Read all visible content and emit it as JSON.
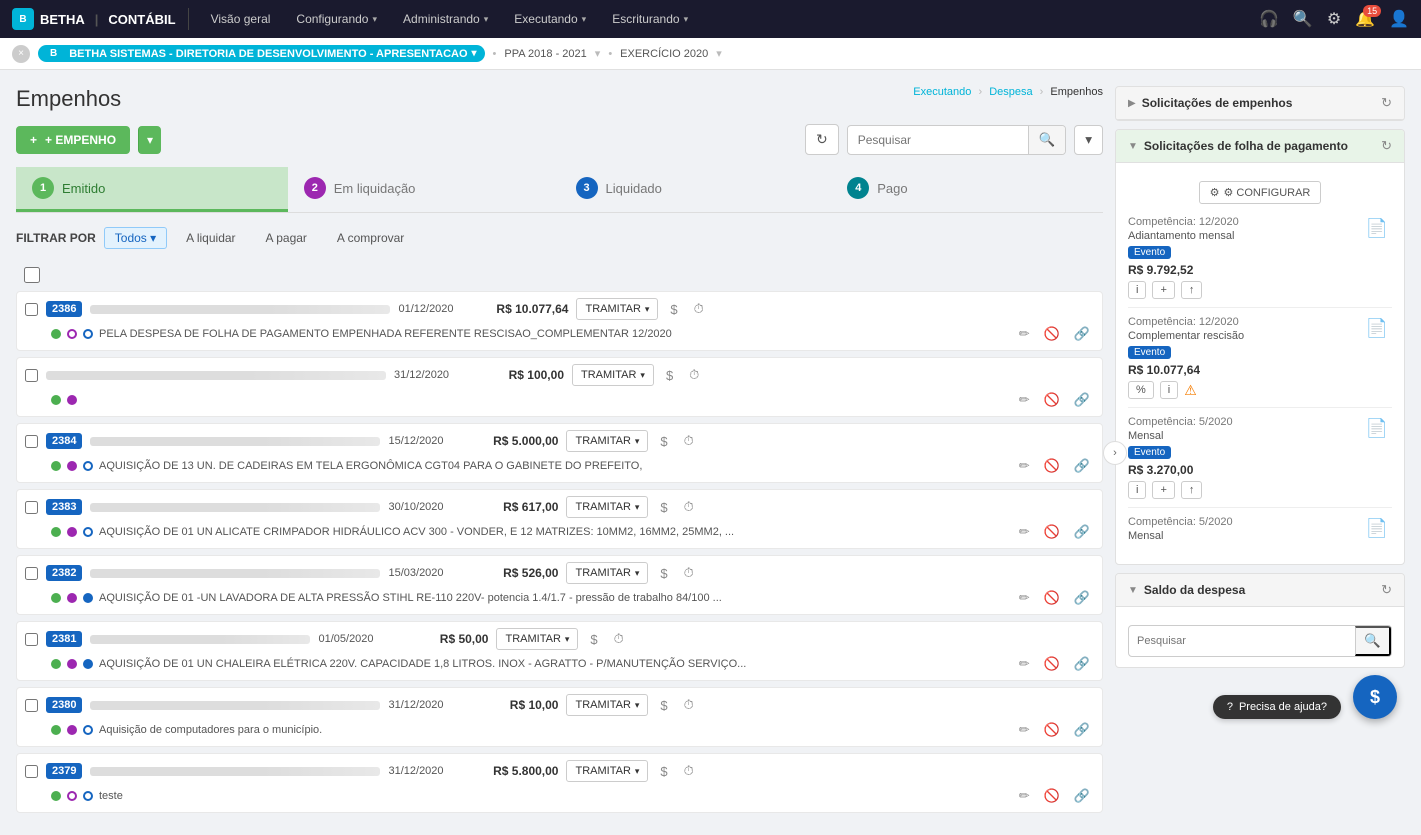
{
  "topNav": {
    "brandIcon": "B",
    "brandName": "BETHA",
    "appName": "CONTÁBIL",
    "navItems": [
      {
        "label": "Visão geral",
        "hasDropdown": false
      },
      {
        "label": "Configurando",
        "hasDropdown": true
      },
      {
        "label": "Administrando",
        "hasDropdown": true
      },
      {
        "label": "Executando",
        "hasDropdown": true
      },
      {
        "label": "Escriturando",
        "hasDropdown": true
      }
    ],
    "icons": {
      "headphones": "🎧",
      "search": "🔍",
      "settings": "⚙",
      "bell": "🔔",
      "user": "👤",
      "bellBadge": "15"
    }
  },
  "breadcrumbBar": {
    "close": "×",
    "logo": "BETHA",
    "orgText": "BETHA SISTEMAS - DIRETORIA DE DESENVOLVIMENTO - APRESENTACAO",
    "ppa": "PPA 2018 - 2021",
    "exercicio": "EXERCÍCIO 2020",
    "chevron": "▾"
  },
  "page": {
    "title": "Empenhos",
    "breadcrumb": [
      "Executando",
      "Despesa",
      "Empenhos"
    ]
  },
  "toolbar": {
    "addLabel": "+ EMPENHO",
    "refreshTitle": "Atualizar",
    "searchPlaceholder": "Pesquisar"
  },
  "tabs": [
    {
      "num": "1",
      "label": "Emitido",
      "active": true
    },
    {
      "num": "2",
      "label": "Em liquidação",
      "active": false
    },
    {
      "num": "3",
      "label": "Liquidado",
      "active": false
    },
    {
      "num": "4",
      "label": "Pago",
      "active": false
    }
  ],
  "filters": {
    "label": "FILTRAR POR",
    "options": [
      "Todos",
      "A liquidar",
      "A pagar",
      "A comprovar"
    ]
  },
  "empenhos": [
    {
      "id": "2386",
      "date": "01/12/2020",
      "value": "R$ 10.077,64",
      "description": "PELA DESPESA DE FOLHA DE PAGAMENTO EMPENHADA REFERENTE RESCISAO_COMPLEMENTAR 12/2020",
      "dots": [
        "green",
        "empty-purple",
        "empty-blue"
      ],
      "action": "TRAMITAR"
    },
    {
      "id": "",
      "date": "31/12/2020",
      "value": "R$ 100,00",
      "description": "",
      "dots": [
        "green",
        "purple"
      ],
      "action": "TRAMITAR"
    },
    {
      "id": "2384",
      "date": "15/12/2020",
      "value": "R$ 5.000,00",
      "description": "AQUISIÇÃO DE 13 UN. DE CADEIRAS EM TELA ERGONÔMICA CGT04 PARA O GABINETE DO PREFEITO,",
      "dots": [
        "green",
        "purple",
        "empty-blue"
      ],
      "action": "TRAMITAR"
    },
    {
      "id": "2383",
      "date": "30/10/2020",
      "value": "R$ 617,00",
      "description": "AQUISIÇÃO DE 01 UN ALICATE CRIMPADOR HIDRÁULICO ACV 300 - VONDER, E 12 MATRIZES: 10MM2, 16MM2, 25MM2, ...",
      "dots": [
        "green",
        "purple",
        "empty-blue"
      ],
      "action": "TRAMITAR"
    },
    {
      "id": "2382",
      "date": "15/03/2020",
      "value": "R$ 526,00",
      "description": "AQUISIÇÃO DE 01 -UN LAVADORA DE ALTA PRESSÃO STIHL RE-110 220V- potencia 1.4/1.7 - pressão de trabalho 84/100 ...",
      "dots": [
        "green",
        "purple",
        "blue"
      ],
      "action": "TRAMITAR"
    },
    {
      "id": "2381",
      "date": "01/05/2020",
      "value": "R$ 50,00",
      "description": "AQUISIÇÃO DE 01 UN CHALEIRA ELÉTRICA 220V. CAPACIDADE 1,8 LITROS. INOX - AGRATTO - P/MANUTENÇÃO SERVIÇO...",
      "dots": [
        "green",
        "purple",
        "blue"
      ],
      "action": "TRAMITAR"
    },
    {
      "id": "2380",
      "date": "31/12/2020",
      "value": "R$ 10,00",
      "description": "Aquisição de computadores para o município.",
      "dots": [
        "green",
        "purple",
        "empty-blue"
      ],
      "action": "TRAMITAR"
    },
    {
      "id": "2379",
      "date": "31/12/2020",
      "value": "R$ 5.800,00",
      "description": "teste",
      "dots": [
        "green",
        "empty-purple",
        "empty-blue"
      ],
      "action": "TRAMITAR"
    }
  ],
  "rightPanel": {
    "solicitacoesEmpenhos": {
      "title": "Solicitações de empenhos",
      "collapsed": true
    },
    "solicitacoesFolha": {
      "title": "Solicitações de folha de pagamento",
      "configureLabel": "⚙ CONFIGURAR",
      "items": [
        {
          "competencia": "Competência: 12/2020",
          "desc": "Adiantamento mensal",
          "badge": "Evento",
          "value": "R$ 9.792,52",
          "actions": [
            "i",
            "+",
            "↑"
          ]
        },
        {
          "competencia": "Competência: 12/2020",
          "desc": "Complementar rescisão",
          "badge": "Evento",
          "value": "R$ 10.077,64",
          "actions": [
            "%",
            "i",
            "⚠"
          ]
        },
        {
          "competencia": "Competência: 5/2020",
          "desc": "Mensal",
          "badge": "Evento",
          "value": "R$ 3.270,00",
          "actions": [
            "i",
            "+",
            "↑"
          ]
        },
        {
          "competencia": "Competência: 5/2020",
          "desc": "Mensal",
          "badge": null,
          "value": null,
          "actions": []
        }
      ]
    },
    "saldoDespesa": {
      "title": "Saldo da despesa",
      "searchPlaceholder": "Pesquisar"
    }
  },
  "fab": "$",
  "helpLabel": "Precisa de ajuda?"
}
